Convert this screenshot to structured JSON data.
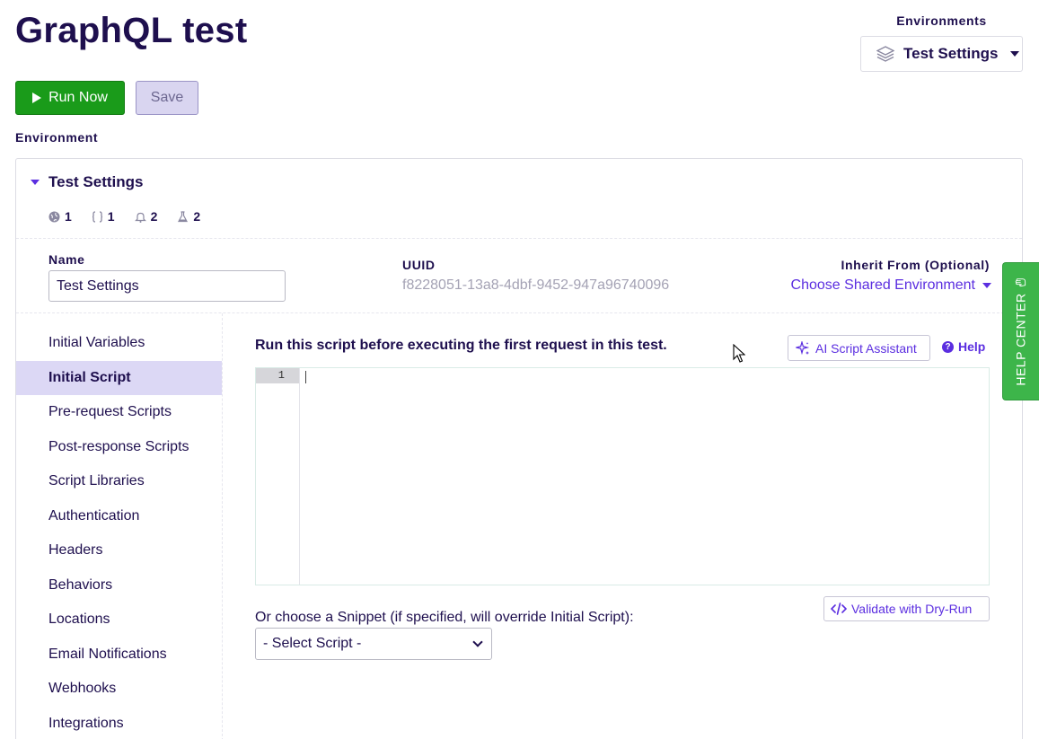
{
  "header": {
    "title": "GraphQL test",
    "environments_label": "Environments",
    "environment_selected": "Test Settings"
  },
  "toolbar": {
    "run_label": "Run Now",
    "save_label": "Save"
  },
  "environment_section_label": "Environment",
  "panel": {
    "title": "Test Settings",
    "stats": [
      {
        "icon": "globe-icon",
        "count": "1"
      },
      {
        "icon": "braces-icon",
        "count": "1"
      },
      {
        "icon": "bell-icon",
        "count": "2"
      },
      {
        "icon": "flask-icon",
        "count": "2"
      }
    ],
    "name_label": "Name",
    "name_value": "Test Settings",
    "uuid_label": "UUID",
    "uuid_value": "f8228051-13a8-4dbf-9452-947a96740096",
    "inherit_label": "Inherit From (Optional)",
    "inherit_value": "Choose Shared Environment"
  },
  "sidebar": {
    "items": [
      {
        "label": "Initial Variables",
        "active": false
      },
      {
        "label": "Initial Script",
        "active": true
      },
      {
        "label": "Pre-request Scripts",
        "active": false
      },
      {
        "label": "Post-response Scripts",
        "active": false
      },
      {
        "label": "Script Libraries",
        "active": false
      },
      {
        "label": "Authentication",
        "active": false
      },
      {
        "label": "Headers",
        "active": false
      },
      {
        "label": "Behaviors",
        "active": false
      },
      {
        "label": "Locations",
        "active": false
      },
      {
        "label": "Email Notifications",
        "active": false
      },
      {
        "label": "Webhooks",
        "active": false
      },
      {
        "label": "Integrations",
        "active": false
      }
    ]
  },
  "script": {
    "title": "Run this script before executing the first request in this test.",
    "ai_button": "AI Script Assistant",
    "help": "Help",
    "line_number": "1",
    "validate_button": "Validate with Dry-Run",
    "snippet_label": "Or choose a Snippet (if specified, will override Initial Script):",
    "snippet_selected": "- Select Script -"
  },
  "help_center": "HELP CENTER",
  "colors": {
    "primary": "#5b2ee0",
    "text": "#1e0f4e",
    "run_green": "#1a9b1a",
    "help_green": "#3db54a",
    "active_bg": "#dcd8f5"
  }
}
